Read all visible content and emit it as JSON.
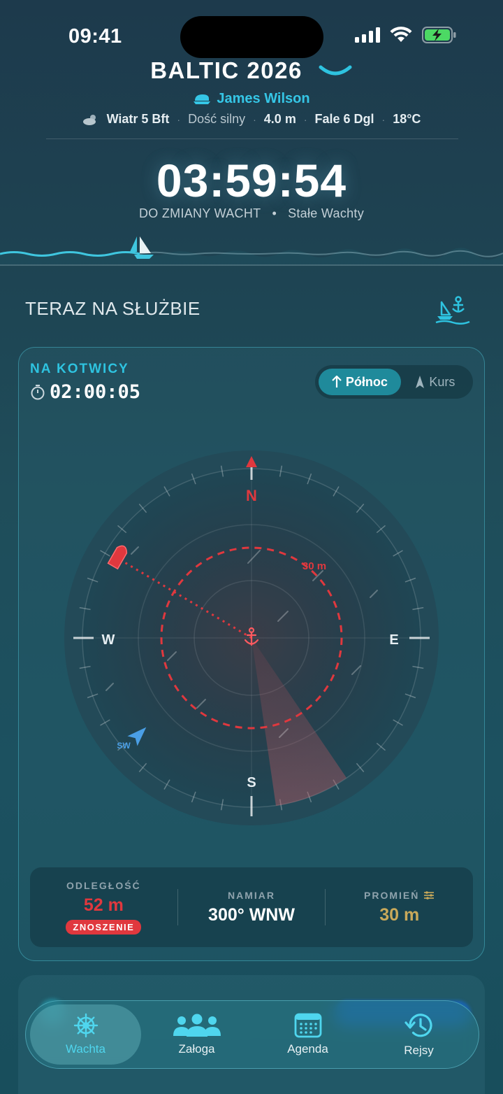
{
  "status_bar": {
    "time": "09:41"
  },
  "header": {
    "trip_title": "BALTIC 2026",
    "captain": "James Wilson",
    "weather": {
      "wind": "Wiatr 5 Bft",
      "wind_desc": "Dość silny",
      "wave_height": "4.0 m",
      "waves": "Fale 6 Dgl",
      "temperature": "18°C"
    },
    "countdown": "03:59:54",
    "countdown_label": "DO ZMIANY WACHT",
    "watch_mode": "Stałe Wachty"
  },
  "section": {
    "title": "TERAZ NA SŁUŻBIE"
  },
  "anchor_card": {
    "label": "NA KOTWICY",
    "elapsed": "02:00:05",
    "toggle": {
      "north": "Północ",
      "course": "Kurs",
      "selected": "north"
    },
    "compass": {
      "n": "N",
      "e": "E",
      "s": "S",
      "w": "W",
      "radius_label": "30 m",
      "wind_label": "SW",
      "boat_bearing_deg": 300,
      "boat_distance_m": 52,
      "radius_m": 30
    },
    "stats": {
      "distance_label": "ODLEGŁOŚĆ",
      "distance_value": "52 m",
      "drift_badge": "ZNOSZENIE",
      "bearing_label": "NAMIAR",
      "bearing_value": "300° WNW",
      "radius_label": "PROMIEŃ",
      "radius_value": "30 m"
    },
    "colors": {
      "alarm": "#e0383e",
      "accent": "#2ec3e0",
      "radius": "#c9a95a"
    }
  },
  "tabbar": {
    "tabs": [
      {
        "label": "Wachta",
        "icon": "ship-wheel-icon",
        "active": true
      },
      {
        "label": "Załoga",
        "icon": "crew-icon",
        "active": false
      },
      {
        "label": "Agenda",
        "icon": "calendar-icon",
        "active": false
      },
      {
        "label": "Rejsy",
        "icon": "history-icon",
        "active": false
      }
    ]
  }
}
